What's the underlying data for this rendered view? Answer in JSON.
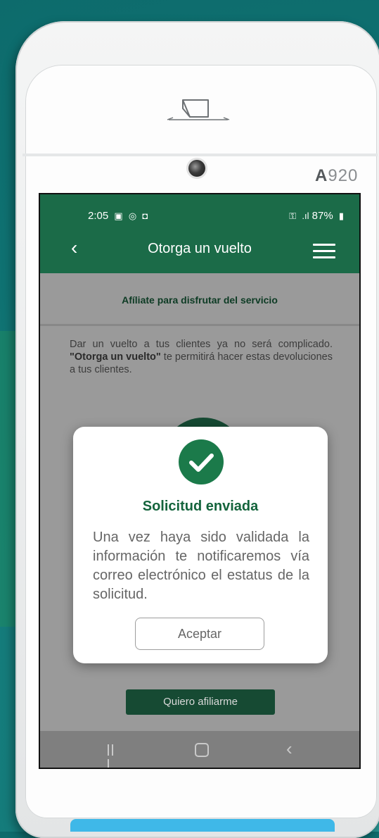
{
  "device": {
    "model_prefix": "A",
    "model_number": "920"
  },
  "status_bar": {
    "time": "2:05",
    "battery": "87%"
  },
  "app_bar": {
    "title": "Otorga un vuelto"
  },
  "content": {
    "banner": "Afíliate para disfrutar del servicio",
    "description_intro": "Dar un vuelto a tus clientes ya no será complicado.",
    "description_bold": "\"Otorga un vuelto\"",
    "description_rest": " te permitirá hacer estas devoluciones a tus clientes.",
    "cta_label": "Quiero afiliarme"
  },
  "dialog": {
    "title": "Solicitud enviada",
    "body": "Una vez haya sido validada la información te notificaremos vía correo electrónico el estatus de la solicitud.",
    "accept_label": "Aceptar"
  },
  "colors": {
    "brand_green": "#1b6b48",
    "dark_green": "#164a33",
    "check_green": "#1b7a4a"
  },
  "icons": [
    "back-arrow-icon",
    "hamburger-menu-icon",
    "check-circle-icon",
    "recents-nav-icon",
    "home-nav-icon",
    "back-nav-icon",
    "printer-slot-icon",
    "camera-icon"
  ]
}
